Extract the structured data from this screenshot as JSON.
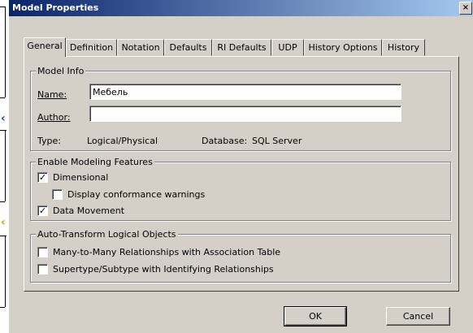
{
  "window": {
    "title": "Model Properties",
    "close_glyph": "×"
  },
  "tabs": [
    {
      "label": "General",
      "active": true
    },
    {
      "label": "Definition"
    },
    {
      "label": "Notation"
    },
    {
      "label": "Defaults"
    },
    {
      "label": "RI Defaults"
    },
    {
      "label": "UDP"
    },
    {
      "label": "History Options"
    },
    {
      "label": "History"
    }
  ],
  "model_info": {
    "legend": "Model Info",
    "name_label": "Name:",
    "name_value": "Мебель",
    "author_label": "Author:",
    "author_value": "",
    "type_label": "Type:",
    "type_value": "Logical/Physical",
    "database_label": "Database:",
    "database_value": "SQL Server"
  },
  "modeling": {
    "legend": "Enable Modeling Features",
    "items": [
      {
        "label": "Dimensional",
        "checked": true
      },
      {
        "label": "Display conformance warnings",
        "checked": false
      },
      {
        "label": "Data Movement",
        "checked": true
      }
    ]
  },
  "auto_transform": {
    "legend": "Auto-Transform Logical Objects",
    "items": [
      {
        "label": "Many-to-Many Relationships with Association Table",
        "checked": false
      },
      {
        "label": "Supertype/Subtype with Identifying Relationships",
        "checked": false
      }
    ]
  },
  "buttons": {
    "ok": "OK",
    "cancel": "Cancel"
  },
  "colors": {
    "titlebar_start": "#0a246a",
    "titlebar_end": "#a6caf0",
    "face": "#d4d0c8"
  }
}
